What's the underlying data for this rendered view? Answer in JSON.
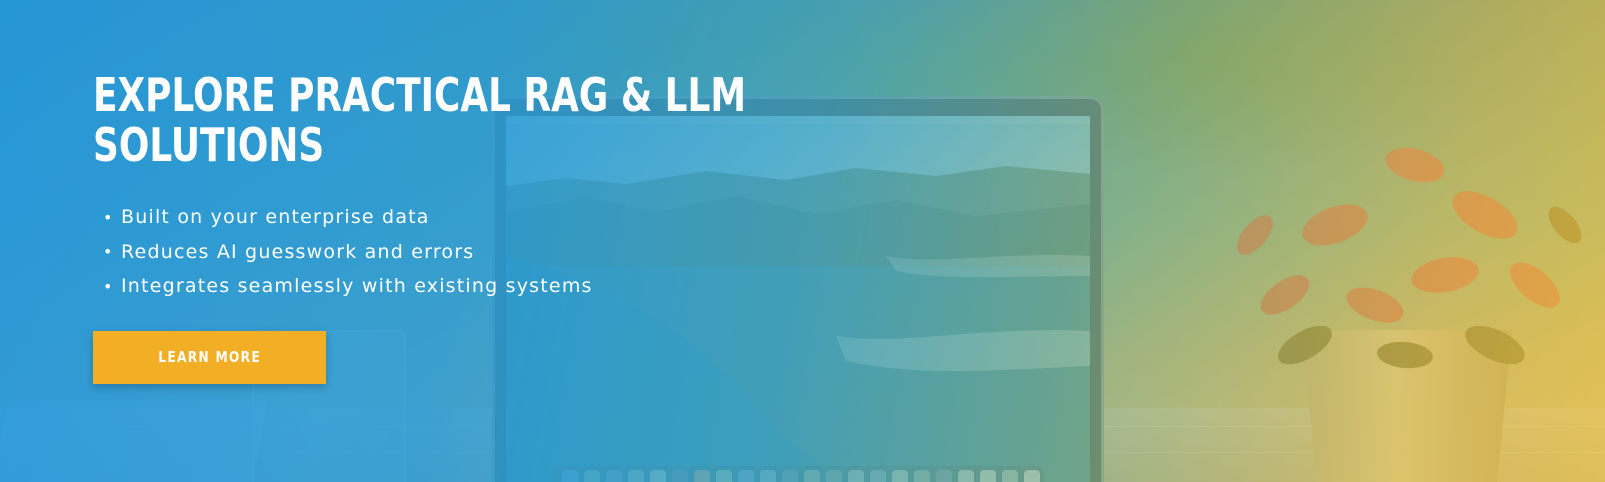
{
  "hero": {
    "headline": "EXPLORE PRACTICAL RAG & LLM SOLUTIONS",
    "bullets": [
      "Built on your enterprise data",
      "Reduces AI guesswork and errors",
      "Integrates seamlessly with existing systems"
    ],
    "cta_label": "LEARN MORE"
  },
  "colors": {
    "overlay_left": "#2296dc",
    "overlay_right": "#f0c33c",
    "cta_background": "#f2ae24",
    "text": "#ffffff"
  },
  "icons": {
    "bullet": "bullet-dot-icon"
  }
}
